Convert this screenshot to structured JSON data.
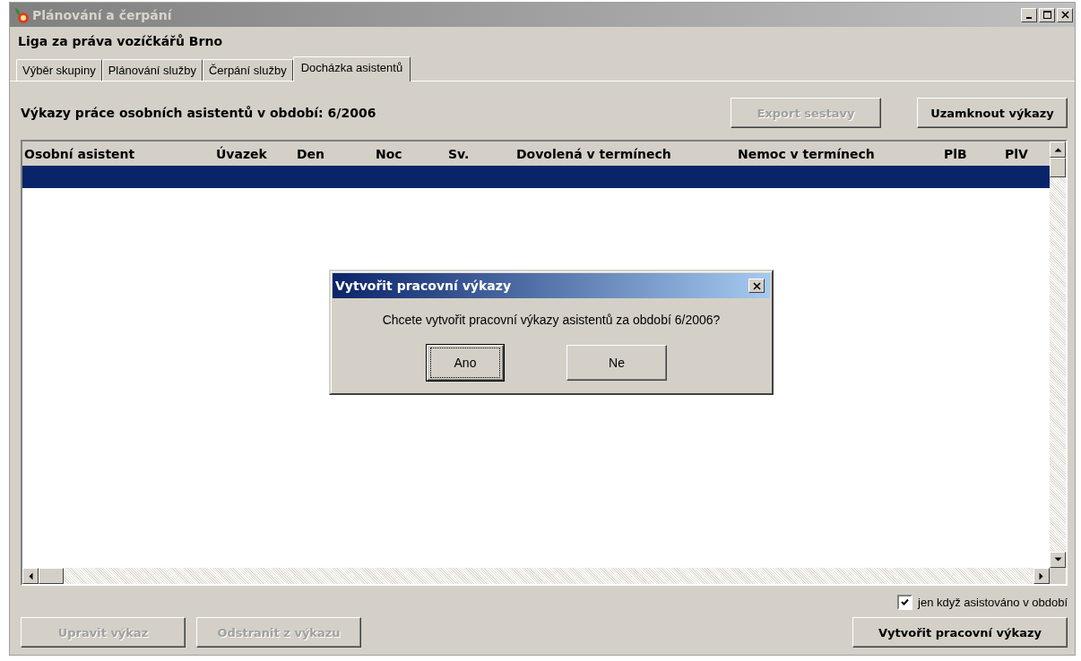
{
  "window": {
    "title": "Plánování a čerpání"
  },
  "organization": "Liga za práva vozíčkářů Brno",
  "tabs": [
    {
      "label": "Výběr skupiny",
      "selected": false
    },
    {
      "label": "Plánování služby",
      "selected": false
    },
    {
      "label": "Čerpání služby",
      "selected": false
    },
    {
      "label": "Docházka asistentů",
      "selected": true
    }
  ],
  "heading": "Výkazy práce osobních asistentů v období: 6/2006",
  "top_buttons": [
    {
      "label": "Export sestavy",
      "disabled": true
    },
    {
      "label": "Uzamknout výkazy",
      "disabled": false
    }
  ],
  "table": {
    "columns": [
      "Osobní asistent",
      "Úvazek",
      "Den",
      "Noc",
      "Sv.",
      "Dovolená v termínech",
      "Nemoc v termínech",
      "PlB",
      "PlV"
    ],
    "rows": [
      {
        "selected": true
      }
    ]
  },
  "filter": {
    "label": "jen když asistováno v období",
    "checked": true
  },
  "bottom_buttons": [
    {
      "label": "Upravit výkaz",
      "disabled": true
    },
    {
      "label": "Odstranit z výkazu",
      "disabled": true
    }
  ],
  "create_button": {
    "label": "Vytvořit pracovní výkazy",
    "disabled": false
  },
  "dialog": {
    "title": "Vytvořit pracovní výkazy",
    "message": "Chcete vytvořit pracovní výkazy asistentů za období 6/2006?",
    "buttons": [
      {
        "label": "Ano",
        "focused": true
      },
      {
        "label": "Ne",
        "focused": false
      }
    ]
  }
}
